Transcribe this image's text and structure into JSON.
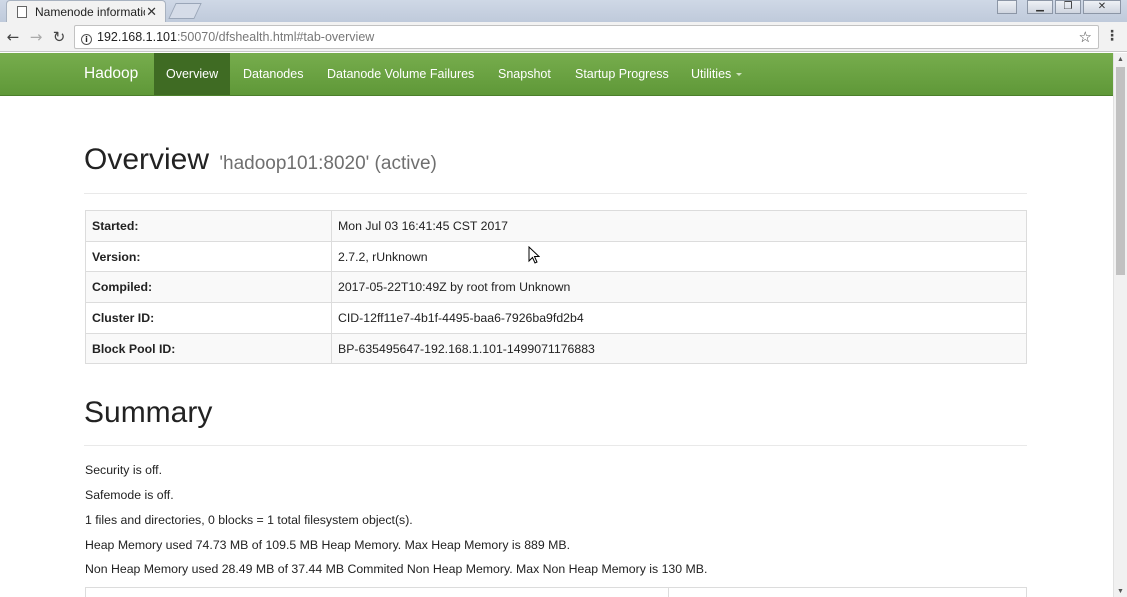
{
  "browser": {
    "tab_title": "Namenode information",
    "tab_close": "✕",
    "address_host": "192.168.1.101",
    "address_rest": ":50070/dfshealth.html#tab-overview",
    "back_icon": "←",
    "forward_icon": "→",
    "reload_icon": "↻",
    "star_icon": "☆",
    "menu_icon": "⋮",
    "win_minimize": "▁",
    "win_maximize": "❐",
    "win_close": "✕"
  },
  "navbar": {
    "brand": "Hadoop",
    "items": [
      {
        "label": "Overview"
      },
      {
        "label": "Datanodes"
      },
      {
        "label": "Datanode Volume Failures"
      },
      {
        "label": "Snapshot"
      },
      {
        "label": "Startup Progress"
      },
      {
        "label": "Utilities"
      }
    ],
    "bg_color": "#6aa343",
    "active_color": "#3f6b23"
  },
  "overview": {
    "title": "Overview",
    "subtitle": "'hadoop101:8020' (active)",
    "rows": [
      {
        "key": "Started:",
        "value": "Mon Jul 03 16:41:45 CST 2017"
      },
      {
        "key": "Version:",
        "value": "2.7.2, rUnknown"
      },
      {
        "key": "Compiled:",
        "value": "2017-05-22T10:49Z by root from Unknown"
      },
      {
        "key": "Cluster ID:",
        "value": "CID-12ff11e7-4b1f-4495-baa6-7926ba9fd2b4"
      },
      {
        "key": "Block Pool ID:",
        "value": "BP-635495647-192.168.1.101-1499071176883"
      }
    ]
  },
  "summary": {
    "title": "Summary",
    "lines": [
      "Security is off.",
      "Safemode is off.",
      "1 files and directories, 0 blocks = 1 total filesystem object(s).",
      "Heap Memory used 74.73 MB of 109.5 MB Heap Memory. Max Heap Memory is 889 MB.",
      "Non Heap Memory used 28.49 MB of 37.44 MB Commited Non Heap Memory. Max Non Heap Memory is 130 MB."
    ]
  }
}
